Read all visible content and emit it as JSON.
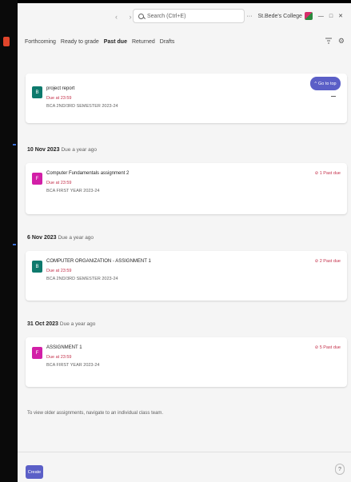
{
  "titlebar": {
    "search_placeholder": "Search (Ctrl+E)",
    "more": "···",
    "org": "St.Bede's College",
    "minimize": "—",
    "maximize": "□",
    "close": "✕"
  },
  "tabs": [
    {
      "label": "Forthcoming",
      "active": false
    },
    {
      "label": "Ready to grade",
      "active": false
    },
    {
      "label": "Past due",
      "active": true
    },
    {
      "label": "Returned",
      "active": false
    },
    {
      "label": "Drafts",
      "active": false
    }
  ],
  "goto_top": "Go to top",
  "groups": [
    {
      "date": "",
      "ago": "",
      "assignments": [
        {
          "title": "project report",
          "due": "Due at 23:59",
          "class": "BCA 2ND/3RD SEMESTER 2023-24",
          "past_due": "",
          "tile_color": "#0e7a6d",
          "tile_letter": "B"
        }
      ]
    },
    {
      "date": "10 Nov 2023",
      "ago": "Due a year ago",
      "assignments": [
        {
          "title": "Computer Fundamentals assignment 2",
          "due": "Due at 23:59",
          "class": "BCA FIRST YEAR 2023-24",
          "past_due": "⊘ 1 Past due",
          "tile_color": "#d21fa7",
          "tile_letter": "F"
        }
      ]
    },
    {
      "date": "6 Nov 2023",
      "ago": "Due a year ago",
      "assignments": [
        {
          "title": "COMPUTER ORGANIZATION - ASSIGNMENT 1",
          "due": "Due at 23:59",
          "class": "BCA 2ND/3RD SEMESTER 2023-24",
          "past_due": "⊘ 2 Past due",
          "tile_color": "#0e7a6d",
          "tile_letter": "B"
        }
      ]
    },
    {
      "date": "31 Oct 2023",
      "ago": "Due a year ago",
      "assignments": [
        {
          "title": "ASSIGNMENT 1",
          "due": "Due at 23:59",
          "class": "BCA FIRST YEAR 2023-24",
          "past_due": "⊘ 5 Past due",
          "tile_color": "#d21fa7",
          "tile_letter": "F"
        }
      ]
    }
  ],
  "footer_note": "To view older assignments, navigate to an individual class team.",
  "create_label": "Create",
  "help_icon": "question-icon",
  "colors": {
    "accent": "#5b5fc7",
    "danger": "#c4314b"
  }
}
